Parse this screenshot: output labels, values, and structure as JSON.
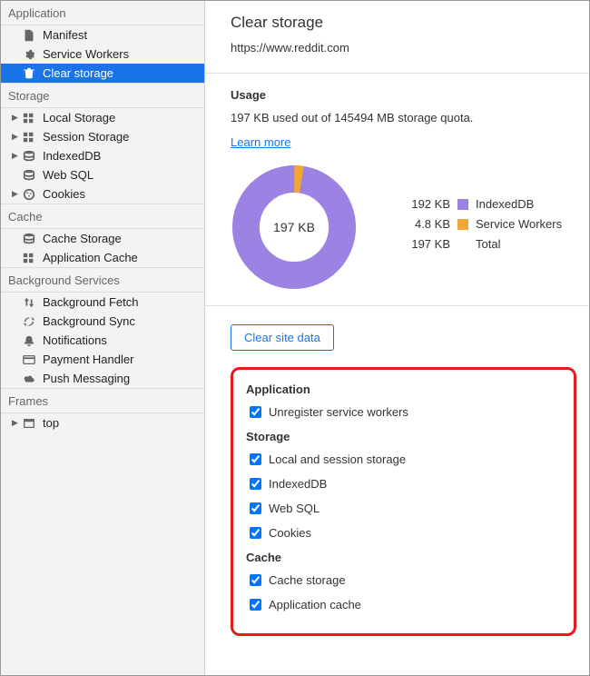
{
  "sidebar": {
    "sections": [
      {
        "title": "Application",
        "items": [
          {
            "label": "Manifest",
            "icon": "file-icon"
          },
          {
            "label": "Service Workers",
            "icon": "gear-icon"
          },
          {
            "label": "Clear storage",
            "icon": "trash-icon",
            "selected": true
          }
        ]
      },
      {
        "title": "Storage",
        "items": [
          {
            "label": "Local Storage",
            "icon": "grid-icon",
            "arrow": true
          },
          {
            "label": "Session Storage",
            "icon": "grid-icon",
            "arrow": true
          },
          {
            "label": "IndexedDB",
            "icon": "database-icon",
            "arrow": true
          },
          {
            "label": "Web SQL",
            "icon": "database-icon"
          },
          {
            "label": "Cookies",
            "icon": "cookie-icon",
            "arrow": true
          }
        ]
      },
      {
        "title": "Cache",
        "items": [
          {
            "label": "Cache Storage",
            "icon": "database-icon"
          },
          {
            "label": "Application Cache",
            "icon": "grid-icon"
          }
        ]
      },
      {
        "title": "Background Services",
        "items": [
          {
            "label": "Background Fetch",
            "icon": "updown-icon"
          },
          {
            "label": "Background Sync",
            "icon": "sync-icon"
          },
          {
            "label": "Notifications",
            "icon": "bell-icon"
          },
          {
            "label": "Payment Handler",
            "icon": "card-icon"
          },
          {
            "label": "Push Messaging",
            "icon": "cloud-icon"
          }
        ]
      },
      {
        "title": "Frames",
        "items": [
          {
            "label": "top",
            "icon": "window-icon",
            "arrow": true
          }
        ]
      }
    ]
  },
  "main": {
    "title": "Clear storage",
    "url": "https://www.reddit.com",
    "usage": {
      "title": "Usage",
      "text": "197 KB used out of 145494 MB storage quota.",
      "learn_more": "Learn more",
      "center": "197 KB",
      "legend": [
        {
          "size": "192 KB",
          "color": "#9b82e3",
          "label": "IndexedDB"
        },
        {
          "size": "4.8 KB",
          "color": "#f3a733",
          "label": "Service Workers"
        },
        {
          "size": "197 KB",
          "color": "",
          "label": "Total"
        }
      ]
    },
    "clear_btn": "Clear site data",
    "groups": [
      {
        "title": "Application",
        "items": [
          "Unregister service workers"
        ]
      },
      {
        "title": "Storage",
        "items": [
          "Local and session storage",
          "IndexedDB",
          "Web SQL",
          "Cookies"
        ]
      },
      {
        "title": "Cache",
        "items": [
          "Cache storage",
          "Application cache"
        ]
      }
    ]
  },
  "chart_data": {
    "type": "pie",
    "title": "Storage usage",
    "series": [
      {
        "name": "IndexedDB",
        "value": 192,
        "unit": "KB",
        "color": "#9b82e3"
      },
      {
        "name": "Service Workers",
        "value": 4.8,
        "unit": "KB",
        "color": "#f3a733"
      }
    ],
    "total": {
      "value": 197,
      "unit": "KB"
    }
  }
}
